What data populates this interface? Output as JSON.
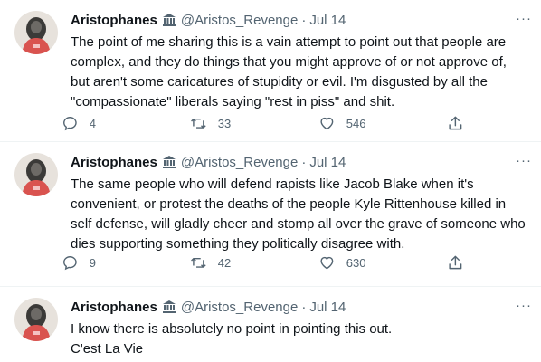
{
  "tweets": [
    {
      "name": "Aristophanes",
      "handle": "@Aristos_Revenge",
      "sep": "·",
      "date": "Jul 14",
      "more": "···",
      "text": [
        "The point of me sharing this is a vain attempt to point out that people are complex, and they do things that you might approve of or not approve of, but aren't some caricatures of stupidity or evil. I'm disgusted by all the \"compassionate\" liberals saying \"rest in piss\" and shit."
      ],
      "replies": "4",
      "retweets": "33",
      "likes": "546"
    },
    {
      "name": "Aristophanes",
      "handle": "@Aristos_Revenge",
      "sep": "·",
      "date": "Jul 14",
      "more": "···",
      "text": [
        "The same people who will defend rapists like Jacob Blake when it's convenient, or protest the deaths of the people Kyle Rittenhouse killed in self defense, will gladly cheer and stomp all over the grave of someone who dies supporting something they politically disagree with."
      ],
      "replies": "9",
      "retweets": "42",
      "likes": "630"
    },
    {
      "name": "Aristophanes",
      "handle": "@Aristos_Revenge",
      "sep": "·",
      "date": "Jul 14",
      "more": "···",
      "text": [
        "I know there is absolutely no point in pointing this out.",
        "C'est La Vie"
      ]
    }
  ],
  "icons": {
    "badge": "government-building-icon",
    "reply": "reply-icon",
    "retweet": "retweet-icon",
    "like": "heart-icon",
    "share": "share-icon"
  },
  "colors": {
    "text": "#0f1419",
    "secondary": "#536471",
    "divider": "#eff3f4"
  }
}
